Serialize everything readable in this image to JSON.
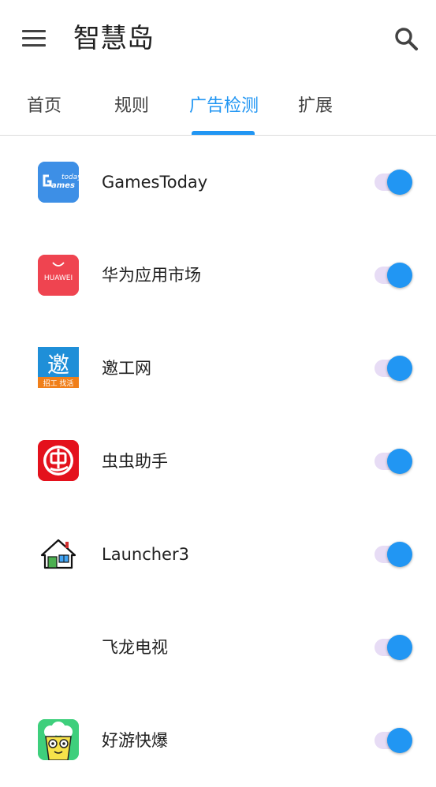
{
  "app_title": "智慧岛",
  "tabs": [
    {
      "label": "首页"
    },
    {
      "label": "规则"
    },
    {
      "label": "广告检测"
    },
    {
      "label": "扩展"
    }
  ],
  "active_tab": "广告检测",
  "colors": {
    "accent": "#2196f3",
    "switch_track": "#e7dcf5"
  },
  "apps": [
    {
      "name": "GamesToday",
      "icon": "gamestoday-icon",
      "icon_text": "today",
      "enabled": true
    },
    {
      "name": "华为应用市场",
      "icon": "huawei-appgallery-icon",
      "icon_text": "HUAWEI",
      "enabled": true
    },
    {
      "name": "邀工网",
      "icon": "yaogong-icon",
      "icon_text": "邀",
      "icon_subtext": "招工 找活",
      "enabled": true
    },
    {
      "name": "虫虫助手",
      "icon": "chongchong-icon",
      "enabled": true
    },
    {
      "name": "Launcher3",
      "icon": "launcher-house-icon",
      "enabled": true
    },
    {
      "name": "飞龙电视",
      "icon": "blank-icon",
      "enabled": true
    },
    {
      "name": "好游快爆",
      "icon": "haoyou-icon",
      "enabled": true
    }
  ]
}
